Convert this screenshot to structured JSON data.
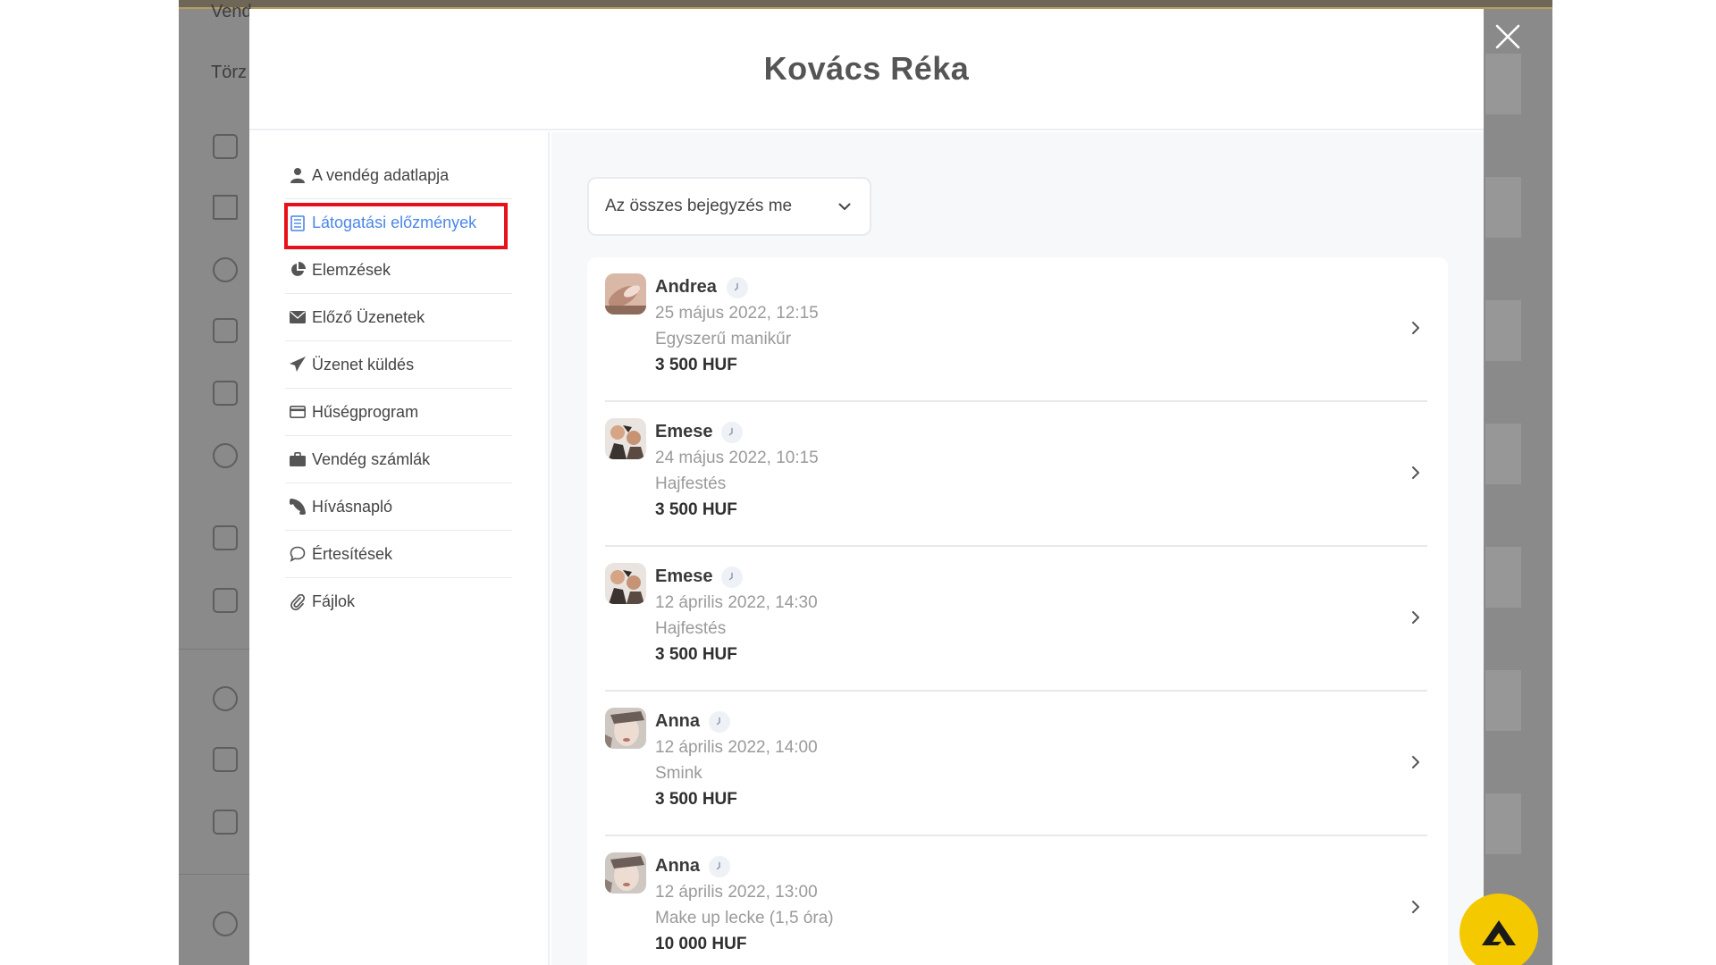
{
  "background": {
    "top_text": "Vend",
    "section_text": "Törz"
  },
  "modal": {
    "title": "Kovács Réka"
  },
  "sidebar": {
    "items": [
      {
        "label": "A vendég adatlapja",
        "icon": "user-icon"
      },
      {
        "label": "Látogatási előzmények",
        "icon": "list-icon"
      },
      {
        "label": "Elemzések",
        "icon": "pie-chart-icon"
      },
      {
        "label": "Előző Üzenetek",
        "icon": "envelope-icon"
      },
      {
        "label": "Üzenet küldés",
        "icon": "paper-plane-icon"
      },
      {
        "label": "Hűségprogram",
        "icon": "credit-card-icon"
      },
      {
        "label": "Vendég számlák",
        "icon": "briefcase-icon"
      },
      {
        "label": "Hívásnapló",
        "icon": "phone-icon"
      },
      {
        "label": "Értesítések",
        "icon": "speech-bubble-icon"
      },
      {
        "label": "Fájlok",
        "icon": "paperclip-icon"
      }
    ]
  },
  "filter": {
    "selected": "Az összes bejegyzés me"
  },
  "visits": [
    {
      "name": "Andrea",
      "date": "25 május 2022, 12:15",
      "service": "Egyszerű manikűr",
      "price": "3 500 HUF"
    },
    {
      "name": "Emese",
      "date": "24 május 2022, 10:15",
      "service": "Hajfestés",
      "price": "3 500 HUF"
    },
    {
      "name": "Emese",
      "date": "12 április 2022, 14:30",
      "service": "Hajfestés",
      "price": "3 500 HUF"
    },
    {
      "name": "Anna",
      "date": "12 április 2022, 14:00",
      "service": "Smink",
      "price": "3 500 HUF"
    },
    {
      "name": "Anna",
      "date": "12 április 2022, 13:00",
      "service": "Make up lecke (1,5 óra)",
      "price": "10 000 HUF"
    }
  ],
  "colors": {
    "accent": "#4a86e8",
    "highlight": "#e8101a",
    "fab": "#f5c900",
    "overlay": "#8a8a8a"
  }
}
